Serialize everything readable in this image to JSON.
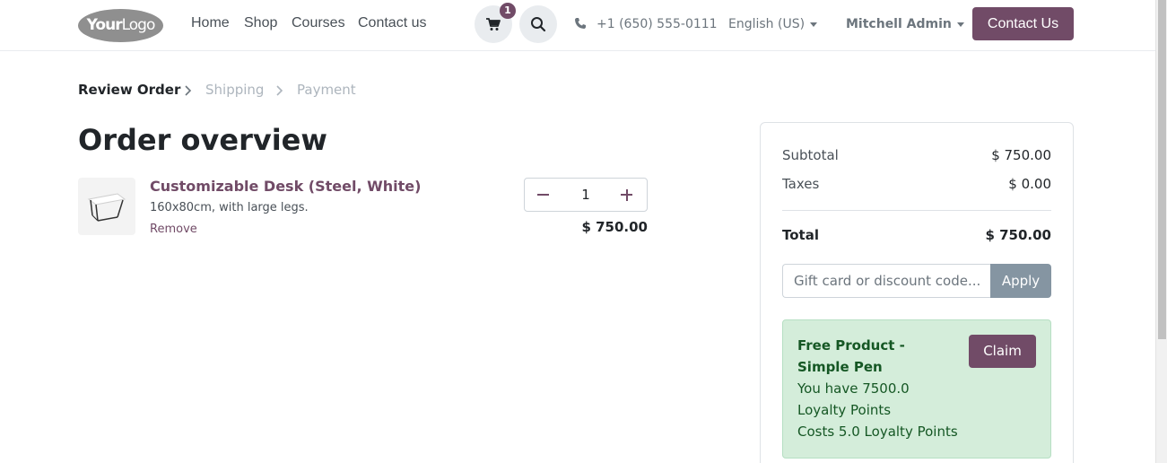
{
  "header": {
    "logo_strong": "Your",
    "logo_light": "Logo",
    "nav": [
      "Home",
      "Shop",
      "Courses",
      "Contact us"
    ],
    "cart_count": "1",
    "phone": "+1 (650) 555-0111",
    "language": "English (US)",
    "user": "Mitchell Admin",
    "contact_button": "Contact Us"
  },
  "checkout_steps": {
    "active": "Review Order",
    "steps": [
      "Shipping",
      "Payment"
    ]
  },
  "page_title": "Order overview",
  "cart_line": {
    "name": "Customizable Desk (Steel, White)",
    "description": "160x80cm, with large legs.",
    "remove_label": "Remove",
    "quantity": "1",
    "price": "$ 750.00"
  },
  "summary": {
    "subtotal_label": "Subtotal",
    "subtotal_value": "$ 750.00",
    "taxes_label": "Taxes",
    "taxes_value": "$ 0.00",
    "total_label": "Total",
    "total_value": "$ 750.00",
    "promo_placeholder": "Gift card or discount code...",
    "apply_label": "Apply"
  },
  "reward": {
    "name": "Free Product - Simple Pen",
    "points_line": "You have 7500.0 Loyalty Points",
    "cost_line": "Costs 5.0 Loyalty Points",
    "claim_label": "Claim"
  },
  "colors": {
    "brand": "#714b67",
    "reward_bg": "#d4edda",
    "reward_text": "#155724",
    "apply_bg": "#8595a2"
  },
  "icons": [
    "cart-icon",
    "search-icon",
    "phone-icon",
    "chevron-right-icon",
    "minus-icon",
    "plus-icon"
  ]
}
